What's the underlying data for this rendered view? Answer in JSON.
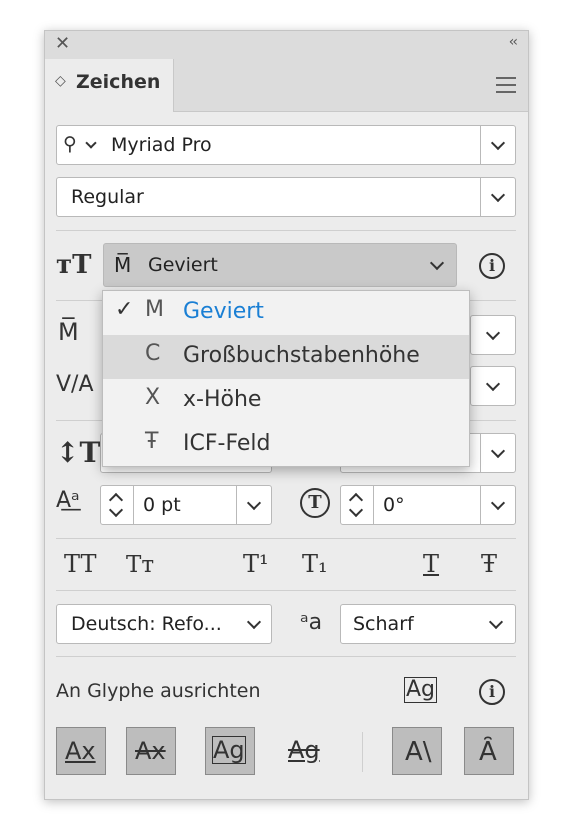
{
  "panel": {
    "title": "Zeichen",
    "font_family": "Myriad Pro",
    "font_style": "Regular",
    "size_reference": "Geviert",
    "leading_value": "",
    "baseline_shift": "0 pt",
    "rotation": "0°",
    "language": "Deutsch: Refo...",
    "antialias": "Scharf",
    "align_glyph_label": "An Glyphe ausrichten"
  },
  "popup": {
    "items": [
      {
        "mark": "M",
        "label": "Geviert",
        "selected": true
      },
      {
        "mark": "C",
        "label": "Großbuchstabenhöhe",
        "highlighted": true
      },
      {
        "mark": "X",
        "label": "x-Höhe"
      },
      {
        "mark": "Ŧ",
        "label": "ICF-Feld"
      }
    ]
  },
  "icons": {
    "tt": "TT",
    "Tt": "Tт",
    "super": "T¹",
    "sub": "T₁",
    "underline": "T",
    "strike": "Ŧ",
    "aa": "ᵃa",
    "info": "i",
    "align_ax": "Ax",
    "align_ag": "Ag"
  }
}
